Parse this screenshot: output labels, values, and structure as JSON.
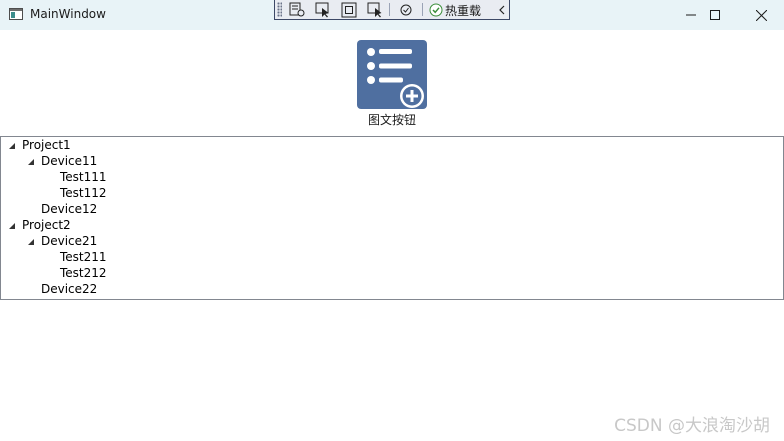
{
  "window": {
    "title": "MainWindow",
    "icon": "window-app-icon",
    "controls": [
      "minimize-icon",
      "maximize-icon",
      "close-icon"
    ]
  },
  "debug_toolbar": {
    "tools": [
      "live-visual-tree-icon",
      "select-element-icon",
      "display-adorners-icon",
      "track-focus-icon",
      "binding-failures-icon"
    ],
    "hot_reload_label": "热重载",
    "hot_reload_icon": "check-circle-icon",
    "collapse_icon": "chevron-left-icon"
  },
  "image_button": {
    "icon": "list-add-icon",
    "label": "图文按钮",
    "color": "#4f6fa0"
  },
  "tree": {
    "items": [
      {
        "label": "Project1",
        "expanded": true
      },
      {
        "label": "Device11",
        "expanded": true
      },
      {
        "label": "Test111"
      },
      {
        "label": "Test112"
      },
      {
        "label": "Device12"
      },
      {
        "label": "Project2",
        "expanded": true
      },
      {
        "label": "Device21",
        "expanded": true
      },
      {
        "label": "Test211"
      },
      {
        "label": "Test212"
      },
      {
        "label": "Device22"
      }
    ]
  },
  "watermark": "CSDN @大浪淘沙胡"
}
